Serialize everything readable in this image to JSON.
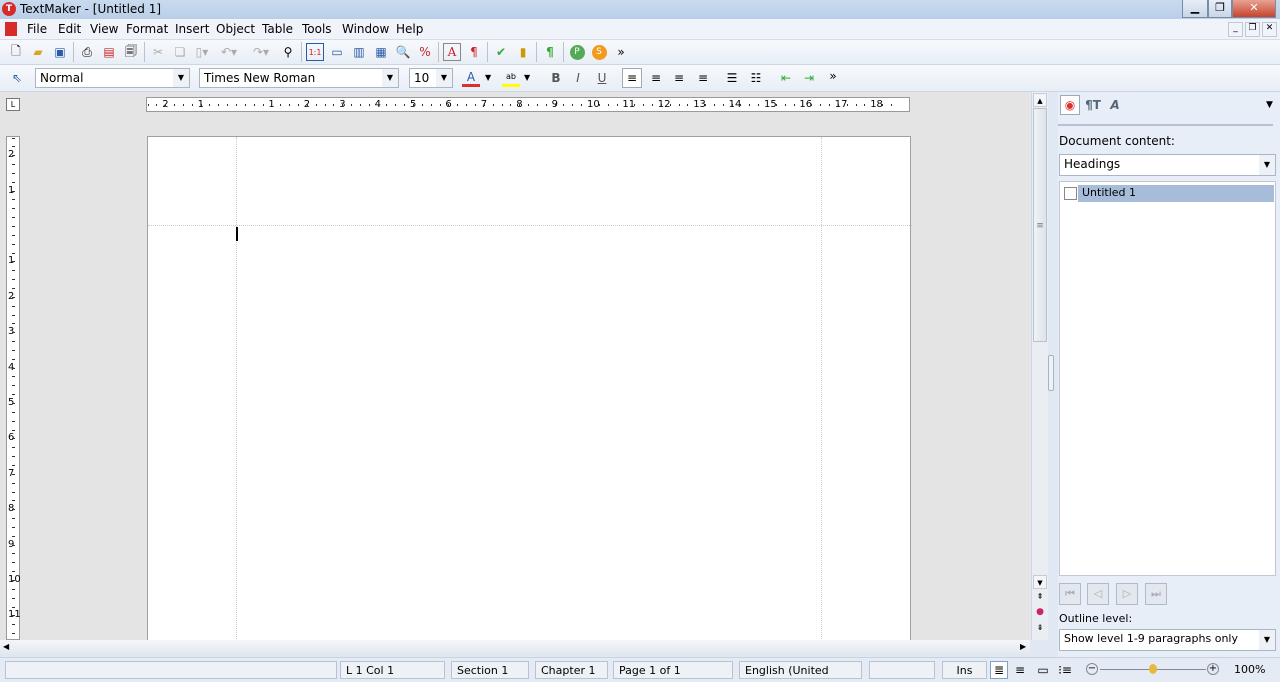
{
  "window": {
    "title": "TextMaker - [Untitled 1]"
  },
  "menu": [
    "File",
    "Edit",
    "View",
    "Format",
    "Insert",
    "Object",
    "Table",
    "Tools",
    "Window",
    "Help"
  ],
  "format_bar": {
    "style": "Normal",
    "font": "Times New Roman",
    "size": "10"
  },
  "ruler": {
    "horizontal": [
      "2",
      "1",
      "1",
      "2",
      "3",
      "4",
      "5",
      "6",
      "7",
      "8",
      "9",
      "10",
      "11",
      "12",
      "13",
      "14",
      "15",
      "16",
      "17",
      "18"
    ],
    "vertical": [
      "2",
      "1",
      "1",
      "2",
      "3",
      "4",
      "5",
      "6",
      "7",
      "8",
      "9",
      "10",
      "11"
    ]
  },
  "panel": {
    "doc_content_label": "Document content:",
    "doc_content_value": "Headings",
    "tree_items": [
      "Untitled 1"
    ],
    "outline_label": "Outline level:",
    "outline_value": "Show level 1-9 paragraphs only"
  },
  "status": {
    "pos": "L 1 Col 1",
    "section": "Section 1",
    "chapter": "Chapter 1",
    "page": "Page 1 of 1",
    "language": "English (United",
    "mode": "Ins",
    "zoom": "100%",
    "zoom_fraction": 0.5
  },
  "colors": {
    "accent": "#d93030",
    "highlight": "#ffff00",
    "selection": "#a6bcd8"
  }
}
